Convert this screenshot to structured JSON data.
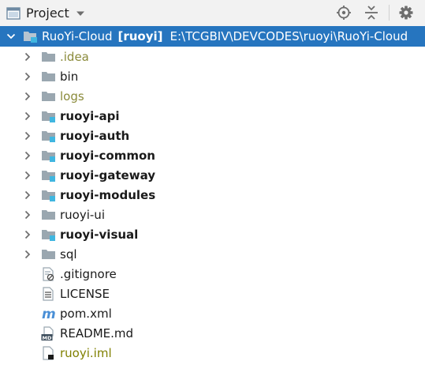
{
  "header": {
    "view_label": "Project",
    "icons": [
      "window-icon",
      "dropdown-caret-icon",
      "locate-target-icon",
      "collapse-all-icon",
      "gear-icon"
    ]
  },
  "tree": {
    "root": {
      "name": "RuoYi-Cloud",
      "tag": "[ruoyi]",
      "path": "E:\\TCGBIV\\DEVCODES\\ruoyi\\RuoYi-Cloud",
      "expanded": true
    },
    "items": [
      {
        "label": ".idea",
        "type": "folder",
        "style": "excluded"
      },
      {
        "label": "bin",
        "type": "folder",
        "style": "normal"
      },
      {
        "label": "logs",
        "type": "folder",
        "style": "excluded"
      },
      {
        "label": "ruoyi-api",
        "type": "module",
        "style": "bold"
      },
      {
        "label": "ruoyi-auth",
        "type": "module",
        "style": "bold"
      },
      {
        "label": "ruoyi-common",
        "type": "module",
        "style": "bold"
      },
      {
        "label": "ruoyi-gateway",
        "type": "module",
        "style": "bold"
      },
      {
        "label": "ruoyi-modules",
        "type": "module",
        "style": "bold"
      },
      {
        "label": "ruoyi-ui",
        "type": "folder",
        "style": "normal"
      },
      {
        "label": "ruoyi-visual",
        "type": "module",
        "style": "bold"
      },
      {
        "label": "sql",
        "type": "folder",
        "style": "normal"
      },
      {
        "label": ".gitignore",
        "type": "gitignore",
        "style": "normal"
      },
      {
        "label": "LICENSE",
        "type": "text",
        "style": "normal"
      },
      {
        "label": "pom.xml",
        "type": "maven",
        "style": "normal"
      },
      {
        "label": "README.md",
        "type": "markdown",
        "style": "normal"
      },
      {
        "label": "ruoyi.iml",
        "type": "iml",
        "style": "olive"
      }
    ]
  },
  "colors": {
    "selection": "#2675bf",
    "folder": "#9aa7b0",
    "module_badge": "#40b6e0",
    "excluded_text": "#8a8a3a"
  }
}
